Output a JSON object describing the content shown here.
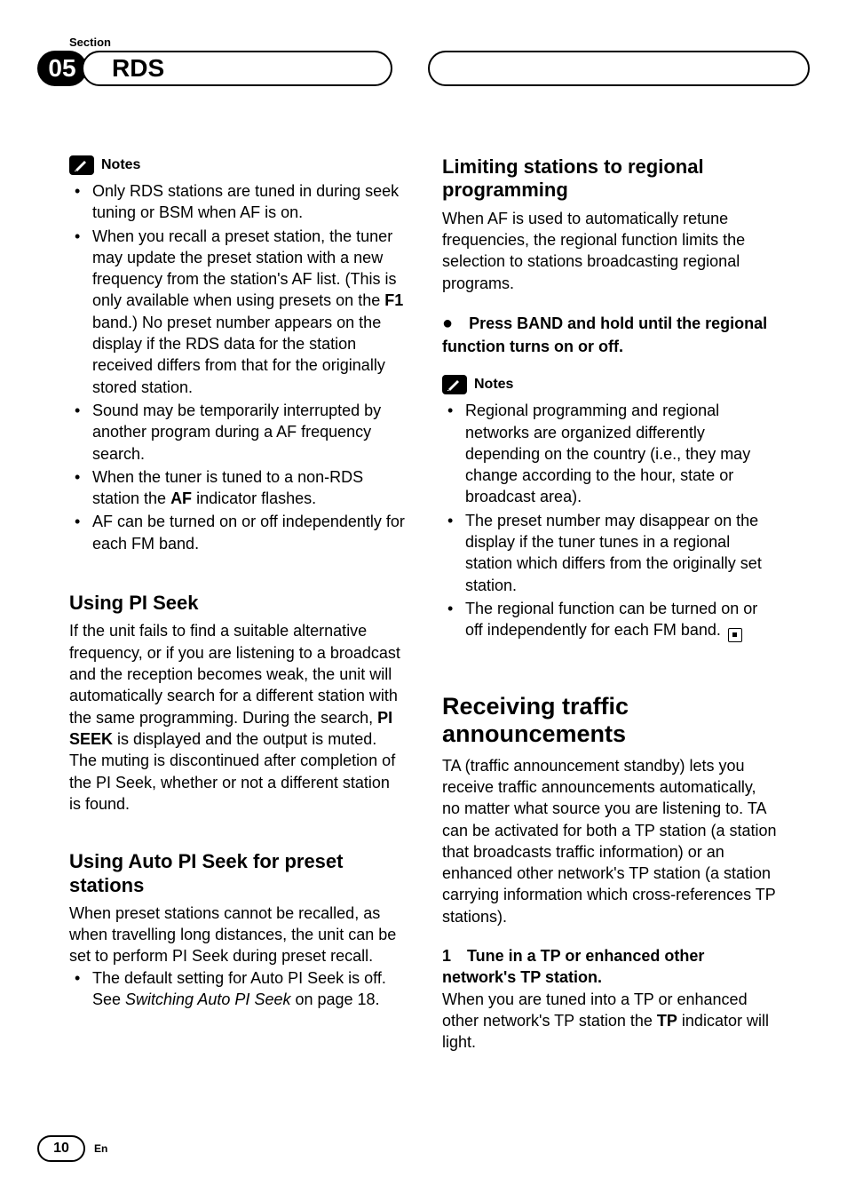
{
  "header": {
    "section_label": "Section",
    "section_number": "05",
    "tab_title": "RDS"
  },
  "left": {
    "notes": {
      "label": "Notes",
      "items": [
        {
          "t": "Only RDS stations are tuned in during seek tuning or BSM when AF is on."
        },
        {
          "pre": "When you recall a preset station, the tuner may update the preset station with a new frequency from the station's AF list. (This is only available when using presets on the ",
          "b": "F1",
          "post": " band.) No preset number appears on the display if the RDS data for the station received differs from that for the originally stored station."
        },
        {
          "t": "Sound may be temporarily interrupted by another program during a AF frequency search."
        },
        {
          "pre": "When the tuner is tuned to a non-RDS station the ",
          "b": "AF",
          "post": " indicator flashes."
        },
        {
          "t": "AF can be turned on or off independently for each FM band."
        }
      ]
    },
    "pi": {
      "title": "Using PI Seek",
      "p1a": "If the unit fails to find a suitable alternative frequency, or if you are listening to a broadcast and the reception becomes weak, the unit will automatically search for a different station with the same programming. During the search, ",
      "p1b": "PI SEEK",
      "p1c": " is displayed and the output is muted. The muting is discontinued after completion of the PI Seek, whether or not a different station is found."
    },
    "autopi": {
      "title": "Using Auto PI Seek for preset stations",
      "p": "When preset stations cannot be recalled, as when travelling long distances, the unit can be set to perform PI Seek during preset recall.",
      "bullet_pre": "The default setting for Auto PI Seek is off. See ",
      "bullet_i": "Switching Auto PI Seek",
      "bullet_post": " on page 18."
    }
  },
  "right": {
    "limit": {
      "title": "Limiting stations to regional programming",
      "p": "When AF is used to automatically retune frequencies, the regional function limits the selection to stations broadcasting regional programs.",
      "cmd": "Press BAND and hold until the regional function turns on or off."
    },
    "notes": {
      "label": "Notes",
      "items": [
        "Regional programming and regional networks are organized differently depending on the country (i.e., they may change according to the hour, state or broadcast area).",
        "The preset number may disappear on the display if the tuner tunes in a regional station which differs from the originally set station.",
        "The regional function can be turned on or off independently for each FM band."
      ]
    },
    "traffic": {
      "title": "Receiving traffic announcements",
      "p": "TA (traffic announcement standby) lets you receive traffic announcements automatically, no matter what source you are listening to. TA can be activated for both a TP station (a station that broadcasts traffic information) or an enhanced other network's TP station (a station carrying information which cross-references TP stations).",
      "step1_num": "1",
      "step1_text": "Tune in a TP or enhanced other network's TP station.",
      "step1_body_a": "When you are tuned into a TP or enhanced other network's TP station the ",
      "step1_body_b": "TP",
      "step1_body_c": " indicator will light."
    }
  },
  "footer": {
    "page": "10",
    "lang": "En"
  }
}
